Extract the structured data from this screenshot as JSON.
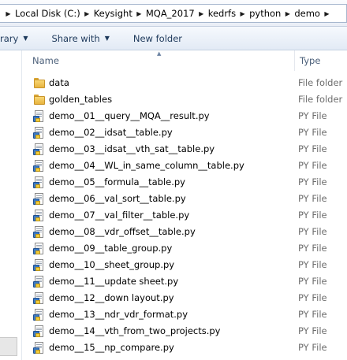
{
  "breadcrumb": [
    "Local Disk (C:)",
    "Keysight",
    "MQA_2017",
    "kedrfs",
    "python",
    "demo"
  ],
  "toolbar": {
    "library_label": "rary",
    "share_label": "Share with",
    "new_folder_label": "New folder"
  },
  "columns": {
    "name": "Name",
    "type": "Type"
  },
  "files": [
    {
      "name": "data",
      "type": "File folder",
      "kind": "folder"
    },
    {
      "name": "golden_tables",
      "type": "File folder",
      "kind": "folder"
    },
    {
      "name": "demo__01__query__MQA__result.py",
      "type": "PY File",
      "kind": "py"
    },
    {
      "name": "demo__02__idsat__table.py",
      "type": "PY File",
      "kind": "py"
    },
    {
      "name": "demo__03__idsat__vth_sat__table.py",
      "type": "PY File",
      "kind": "py"
    },
    {
      "name": "demo__04__WL_in_same_column__table.py",
      "type": "PY File",
      "kind": "py"
    },
    {
      "name": "demo__05__formula__table.py",
      "type": "PY File",
      "kind": "py"
    },
    {
      "name": "demo__06__val_sort__table.py",
      "type": "PY File",
      "kind": "py"
    },
    {
      "name": "demo__07__val_filter__table.py",
      "type": "PY File",
      "kind": "py"
    },
    {
      "name": "demo__08__vdr_offset__table.py",
      "type": "PY File",
      "kind": "py"
    },
    {
      "name": "demo__09__table_group.py",
      "type": "PY File",
      "kind": "py"
    },
    {
      "name": "demo__10__sheet_group.py",
      "type": "PY File",
      "kind": "py"
    },
    {
      "name": "demo__11__update sheet.py",
      "type": "PY File",
      "kind": "py"
    },
    {
      "name": "demo__12__down layout.py",
      "type": "PY File",
      "kind": "py"
    },
    {
      "name": "demo__13__ndr_vdr_format.py",
      "type": "PY File",
      "kind": "py"
    },
    {
      "name": "demo__14__vth_from_two_projects.py",
      "type": "PY File",
      "kind": "py"
    },
    {
      "name": "demo__15__np_compare.py",
      "type": "PY File",
      "kind": "py"
    }
  ]
}
